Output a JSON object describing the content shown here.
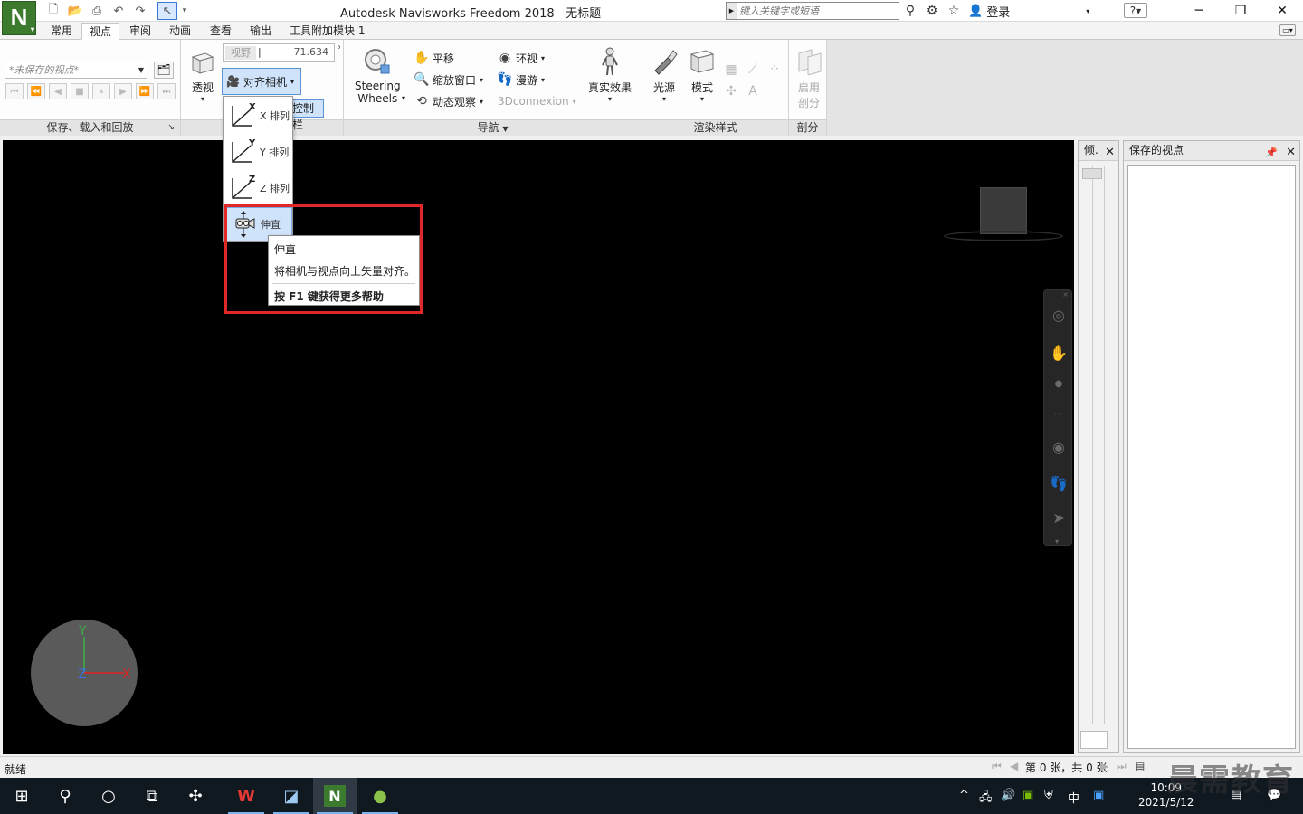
{
  "app": {
    "title": "Autodesk Navisworks Freedom 2018",
    "document": "无标题",
    "logo_letter": "N"
  },
  "search": {
    "placeholder": "键入关键字或短语"
  },
  "signin": {
    "label": "登录"
  },
  "ribbon_tabs": [
    "常用",
    "视点",
    "审阅",
    "动画",
    "查看",
    "输出",
    "工具附加模块 1"
  ],
  "active_tab": "视点",
  "panel_save": {
    "combo_value": "*未保存的视点*",
    "label": "保存、载入和回放"
  },
  "panel_camera": {
    "perspective_label": "透视",
    "fov_label": "视野",
    "fov_value": "71.634",
    "fov_unit": "°",
    "align_camera_label": "对齐相机",
    "hud_label": "控制栏"
  },
  "panel_navigate": {
    "steering_wheels_line1": "Steering",
    "steering_wheels_line2": "Wheels",
    "pan": "平移",
    "zoom_window": "缩放窗口",
    "orbit": "动态观察",
    "look_around": "环视",
    "walk": "漫游",
    "connexion": "3Dconnexion",
    "realism": "真实效果",
    "label": "导航"
  },
  "panel_render": {
    "lighting": "光源",
    "mode": "模式",
    "label": "渲染样式"
  },
  "panel_section": {
    "enable_line1": "启用",
    "enable_line2": "剖分",
    "label": "剖分"
  },
  "align_menu": {
    "items": [
      {
        "axis": "X",
        "label": "X 排列"
      },
      {
        "axis": "Y",
        "label": "Y 排列"
      },
      {
        "axis": "Z",
        "label": "Z 排列"
      },
      {
        "axis": "",
        "label": "伸直"
      }
    ]
  },
  "tooltip": {
    "title": "伸直",
    "description": "将相机与视点向上矢量对齐。",
    "help": "按 F1 键获得更多帮助"
  },
  "tilt_panel": {
    "title": "倾."
  },
  "saved_viewpoints_panel": {
    "title": "保存的视点"
  },
  "status": {
    "text": "就绪",
    "page_info": "第 0 张，共 0 张"
  },
  "gizmo": {
    "y": "Y",
    "z": "Z",
    "x": "X"
  },
  "watermark": "晨需教育",
  "taskbar": {
    "time": "10:09",
    "date": "2021/5/12",
    "ime": "中"
  },
  "colors": {
    "viewport_bg": "#000000",
    "accent_blue": "#cfe3fb",
    "highlight_red": "#e02828",
    "logo_green": "#3c7a2e"
  }
}
